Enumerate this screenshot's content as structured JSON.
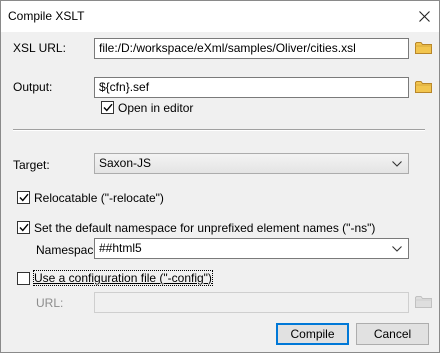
{
  "window": {
    "title": "Compile XSLT"
  },
  "xsl_url": {
    "label": "XSL URL:",
    "value": "file:/D:/workspace/eXml/samples/Oliver/cities.xsl"
  },
  "output": {
    "label": "Output:",
    "value": "${cfn}.sef",
    "open_in_editor": {
      "label": "Open in editor",
      "checked": true
    }
  },
  "target": {
    "label": "Target:",
    "selected": "Saxon-JS"
  },
  "relocatable": {
    "label": "Relocatable (\"-relocate\")",
    "checked": true
  },
  "default_namespace": {
    "label": "Set the default namespace for unprefixed element names (\"-ns\")",
    "checked": true,
    "namespace_label": "Namespace:",
    "namespace_value": "##html5"
  },
  "config_file": {
    "label": "Use a configuration file (\"-config\")",
    "checked": false,
    "url_label": "URL:",
    "url_value": ""
  },
  "buttons": {
    "compile": "Compile",
    "cancel": "Cancel"
  },
  "icons": {
    "close": "close-icon",
    "folder": "folder-icon",
    "dropdown": "chevron-down-icon",
    "check": "checkmark-icon"
  },
  "colors": {
    "folder": "#e8b54a",
    "accent": "#0078d7"
  }
}
